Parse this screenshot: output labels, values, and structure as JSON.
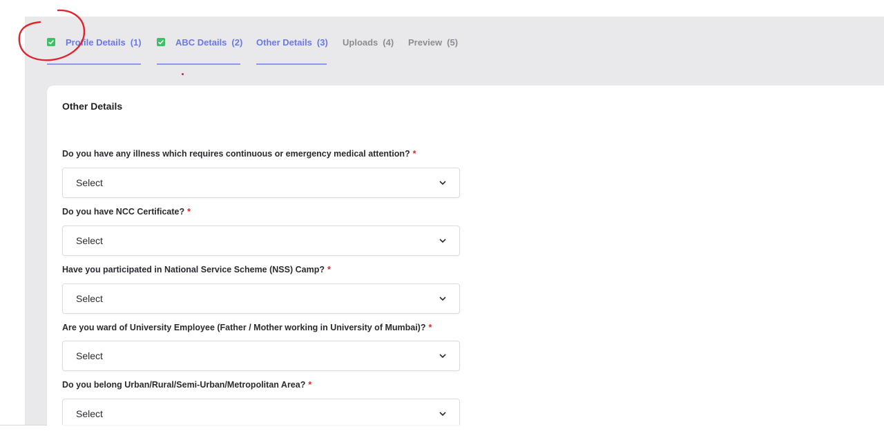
{
  "tabs": [
    {
      "label": "Profile Details",
      "number": "(1)",
      "state": "done"
    },
    {
      "label": "ABC Details",
      "number": "(2)",
      "state": "done"
    },
    {
      "label": "Other Details",
      "number": "(3)",
      "state": "active"
    },
    {
      "label": "Uploads",
      "number": "(4)",
      "state": "pending"
    },
    {
      "label": "Preview",
      "number": "(5)",
      "state": "pending"
    }
  ],
  "section": {
    "title": "Other Details"
  },
  "required_mark": "*",
  "questions": [
    {
      "label": "Do you have any illness which requires continuous or emergency medical attention?",
      "value": "Select"
    },
    {
      "label": "Do you have NCC Certificate?",
      "value": "Select"
    },
    {
      "label": "Have you participated in National Service Scheme (NSS) Camp?",
      "value": "Select"
    },
    {
      "label": "Are you ward of University Employee (Father / Mother working in University of Mumbai)?",
      "value": "Select"
    },
    {
      "label": "Do you belong Urban/Rural/Semi-Urban/Metropolitan Area?",
      "value": "Select"
    }
  ],
  "icons": {
    "check": "checkbox-checked-icon",
    "chevron": "chevron-down-icon"
  },
  "colors": {
    "accent": "#6b78e6",
    "check_green": "#3fbf6a",
    "required_red": "#e0242c",
    "annotation_red": "#e0242c",
    "background": "#e9e8ea"
  }
}
